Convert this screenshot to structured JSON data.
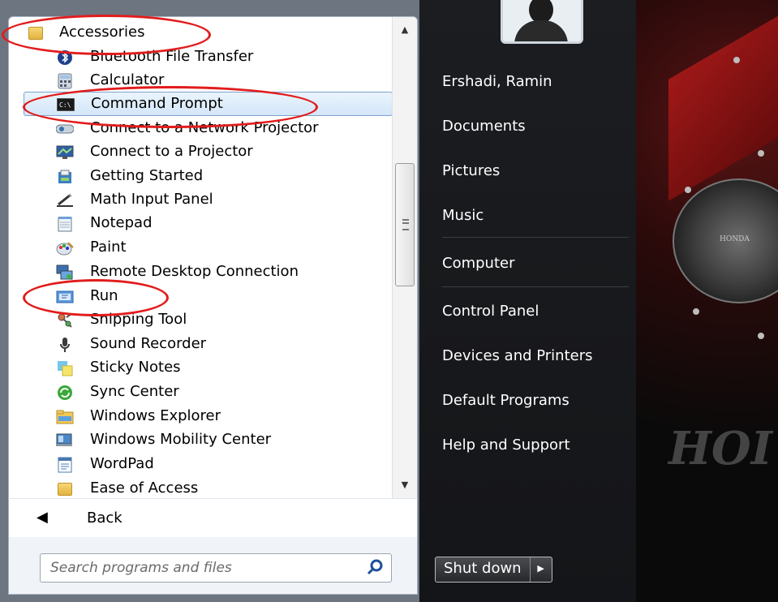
{
  "programs": {
    "items": [
      {
        "label": "Accessories",
        "icon": "folder-icon"
      },
      {
        "label": "Bluetooth File Transfer",
        "icon": "bluetooth-icon"
      },
      {
        "label": "Calculator",
        "icon": "calculator-icon"
      },
      {
        "label": "Command Prompt",
        "icon": "command-prompt-icon",
        "selected": true
      },
      {
        "label": "Connect to a Network Projector",
        "icon": "network-projector-icon"
      },
      {
        "label": "Connect to a Projector",
        "icon": "projector-icon"
      },
      {
        "label": "Getting Started",
        "icon": "getting-started-icon"
      },
      {
        "label": "Math Input Panel",
        "icon": "math-input-icon"
      },
      {
        "label": "Notepad",
        "icon": "notepad-icon"
      },
      {
        "label": "Paint",
        "icon": "paint-icon"
      },
      {
        "label": "Remote Desktop Connection",
        "icon": "remote-desktop-icon"
      },
      {
        "label": "Run",
        "icon": "run-icon"
      },
      {
        "label": "Snipping Tool",
        "icon": "snipping-tool-icon"
      },
      {
        "label": "Sound Recorder",
        "icon": "microphone-icon"
      },
      {
        "label": "Sticky Notes",
        "icon": "sticky-notes-icon"
      },
      {
        "label": "Sync Center",
        "icon": "sync-icon"
      },
      {
        "label": "Windows Explorer",
        "icon": "explorer-folder-icon"
      },
      {
        "label": "Windows Mobility Center",
        "icon": "mobility-center-icon"
      },
      {
        "label": "WordPad",
        "icon": "wordpad-icon"
      },
      {
        "label": "Ease of Access",
        "icon": "folder-icon"
      }
    ]
  },
  "back": {
    "label": "Back"
  },
  "search": {
    "placeholder": "Search programs and files"
  },
  "right": {
    "user": "Ershadi, Ramin",
    "documents": "Documents",
    "pictures": "Pictures",
    "music": "Music",
    "computer": "Computer",
    "control_panel": "Control Panel",
    "devices": "Devices and Printers",
    "default_programs": "Default Programs",
    "help": "Help and Support"
  },
  "shutdown": {
    "label": "Shut down"
  },
  "wallpaper": {
    "brand": "HONDA",
    "brand_big": "HOI"
  },
  "colors": {
    "highlight_ring": "#e21c1c",
    "selected_bg": "#d3e6f9"
  }
}
